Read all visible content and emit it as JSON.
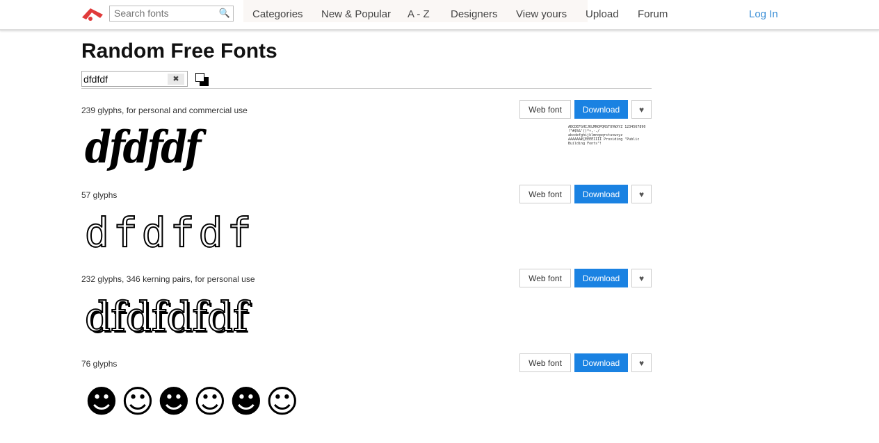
{
  "header": {
    "search_placeholder": "Search fonts",
    "nav": [
      "Categories",
      "New & Popular",
      "A - Z",
      "Designers",
      "View yours",
      "Upload",
      "Forum"
    ],
    "login": "Log In"
  },
  "page": {
    "title": "Random Free Fonts",
    "preview_text": "dfdfdf",
    "clear_label": "✖"
  },
  "buttons": {
    "webfont": "Web font",
    "download": "Download",
    "favorite": "♥"
  },
  "fonts": [
    {
      "info": "239 glyphs, for personal and commercial use",
      "sample": "dfdfdf",
      "specimen": "ABCDEFGHIJKLMNOPQRSTUVWXYZ 1234567890 !\"#$%&'()*+,-./ abcdefghijklmnopqrstuvwxyz AAAAAAÆÇÈÉÊËÌÍÎÏ Providing \"Public Building Fonts\"!"
    },
    {
      "info": "57 glyphs",
      "sample": "dfdfdf"
    },
    {
      "info": "232 glyphs, 346 kerning pairs, for personal use",
      "sample": "dfdfdfdf"
    },
    {
      "info": "76 glyphs",
      "sample": "☻☺☻☺☻☺"
    }
  ],
  "colors": {
    "accent": "#1a82e2",
    "logo": "#e03a3a",
    "link": "#3a8ed6"
  }
}
